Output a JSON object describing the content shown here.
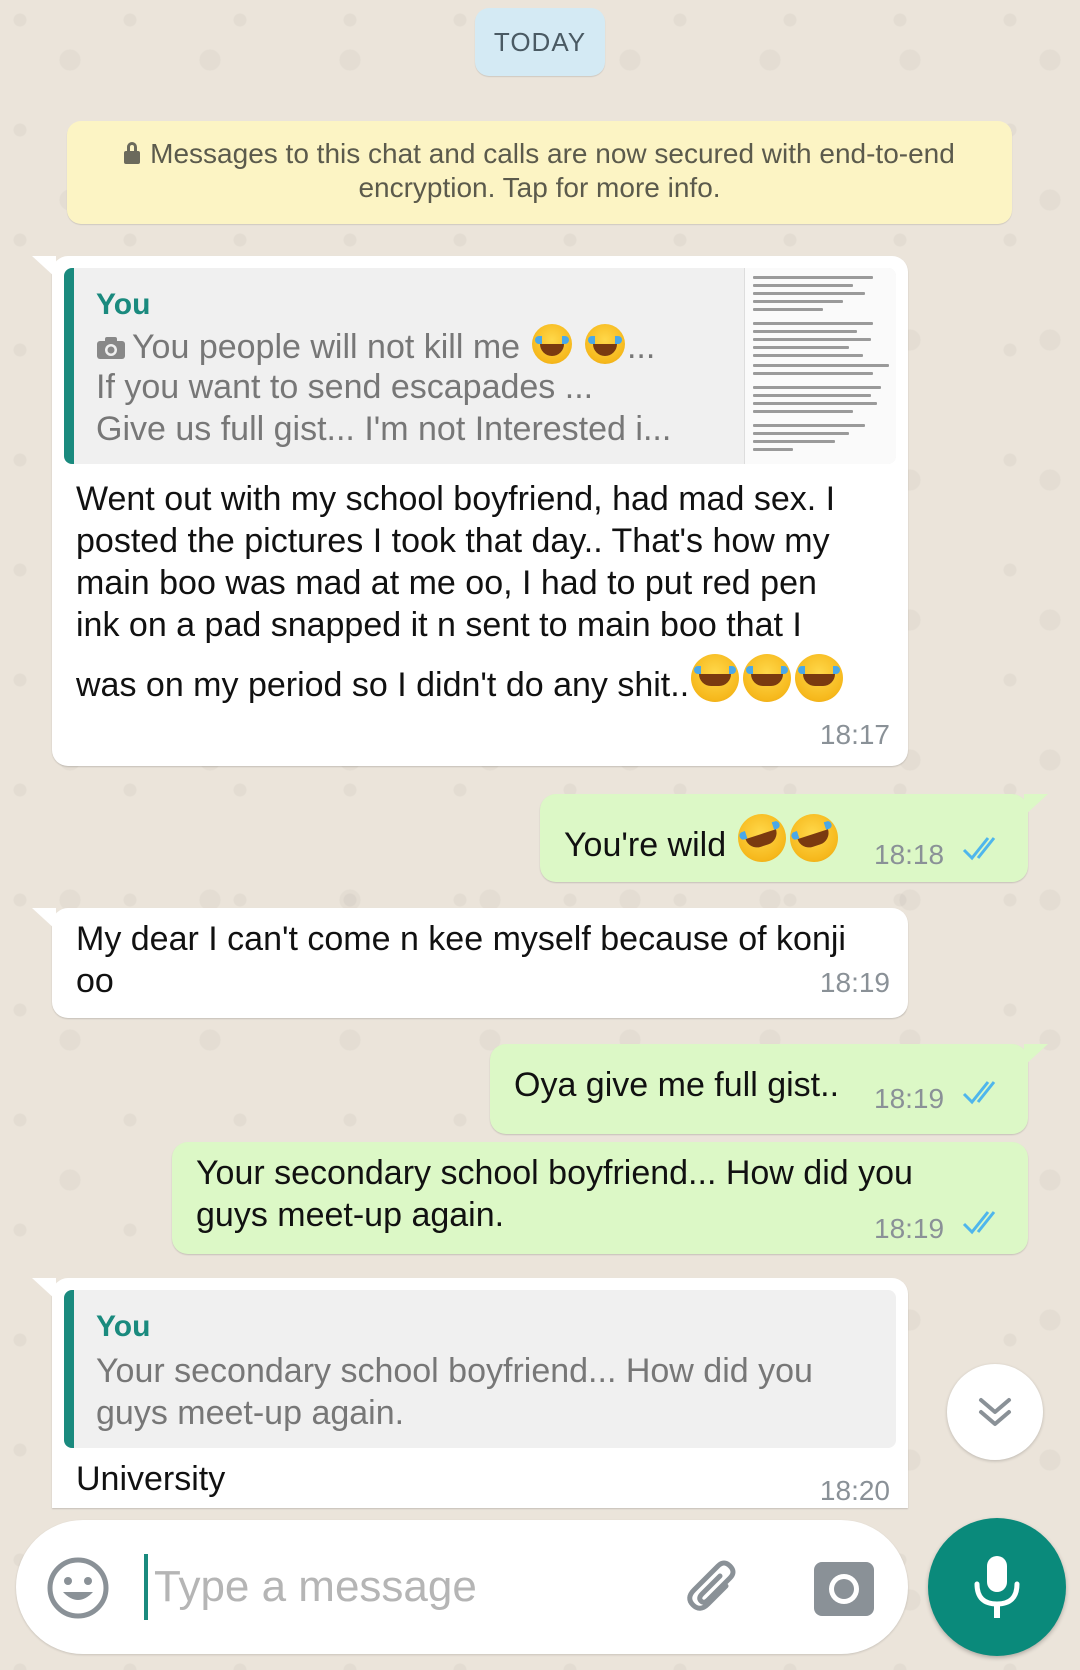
{
  "date_chip": "TODAY",
  "encryption_notice": "Messages to this chat and calls are now secured with end-to-end encryption. Tap for more info.",
  "messages": [
    {
      "direction": "incoming",
      "quote": {
        "author": "You",
        "lines": [
          "You people will not kill me",
          "If you want to send escapades ...",
          "Give us full gist... I'm not Interested i..."
        ],
        "has_photo_thumbnail": true
      },
      "text_lines": [
        "Went out with my school boyfriend, had mad sex. I",
        "posted the pictures I took that day.. That's how my",
        "main boo was mad at me oo, I had to put red pen",
        "ink on a pad snapped it n sent to main boo that I",
        "was on my period so I didn't do any shit.."
      ],
      "time": "18:17"
    },
    {
      "direction": "outgoing",
      "text": "You're wild",
      "time": "18:18",
      "status": "read"
    },
    {
      "direction": "incoming",
      "text_lines": [
        "My dear I can't come n kee myself because of konji",
        "oo"
      ],
      "time": "18:19"
    },
    {
      "direction": "outgoing",
      "text": "Oya give me full gist..",
      "time": "18:19",
      "status": "read"
    },
    {
      "direction": "outgoing",
      "text_lines": [
        "Your secondary school boyfriend... How did you",
        "guys meet-up again."
      ],
      "time": "18:19",
      "status": "read"
    },
    {
      "direction": "incoming",
      "quote": {
        "author": "You",
        "lines": [
          "Your secondary school boyfriend... How did you",
          "guys meet-up again."
        ]
      },
      "text": "University",
      "time": "18:20"
    }
  ],
  "composer": {
    "placeholder": "Type a message"
  },
  "colors": {
    "outgoing_bubble": "#dcf8c6",
    "incoming_bubble": "#ffffff",
    "accent": "#1a8a7e",
    "read_ticks": "#4fb6ec",
    "mic_button": "#0a8a7b"
  },
  "icons": [
    "lock-icon",
    "camera-icon",
    "emoji-icon",
    "attach-icon",
    "camera-button-icon",
    "mic-icon",
    "chevron-double-down-icon",
    "double-check-icon"
  ]
}
